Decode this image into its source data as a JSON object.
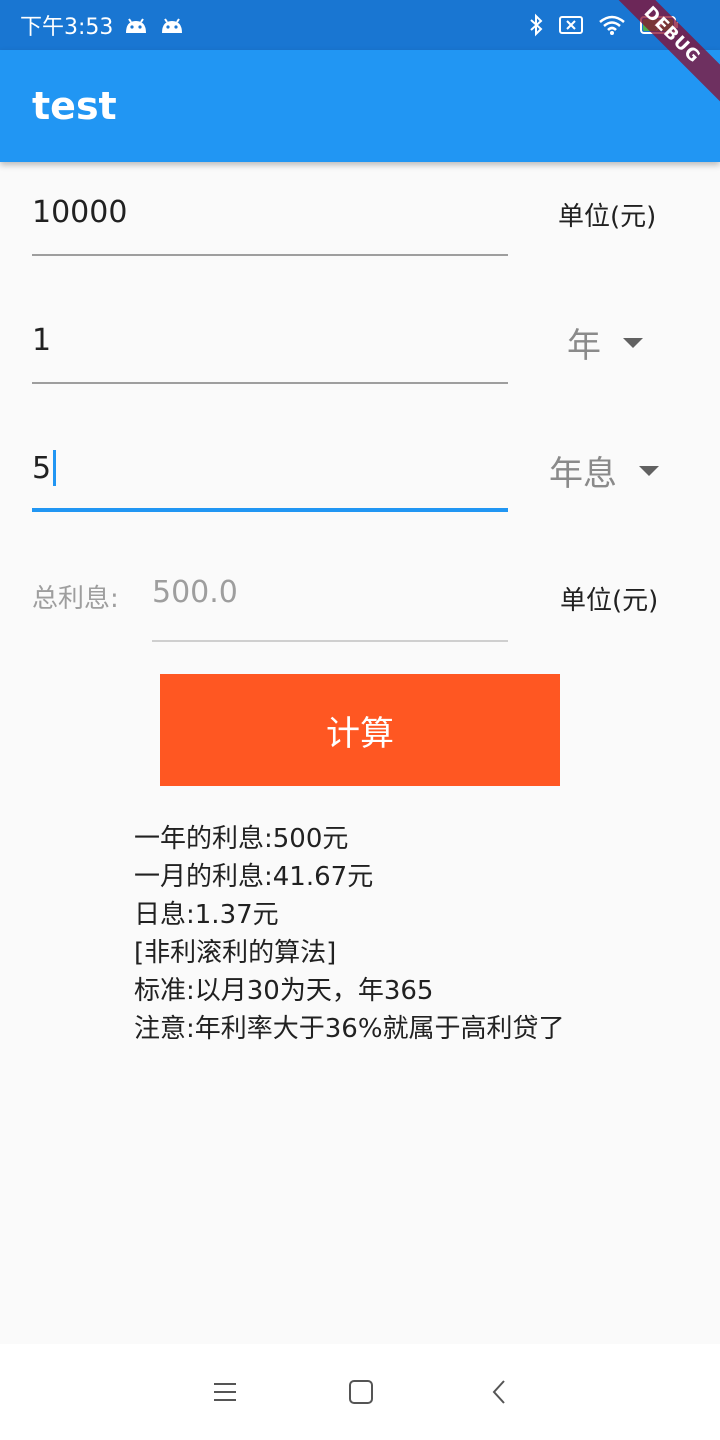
{
  "status_bar": {
    "time": "下午3:53",
    "icons": [
      "android-icon",
      "android-icon",
      "bluetooth-icon",
      "no-sim-icon",
      "wifi-icon",
      "battery-charging-icon"
    ]
  },
  "debug_banner": "DEBUG",
  "app_bar": {
    "title": "test"
  },
  "form": {
    "principal": {
      "value": "10000",
      "unit": "单位(元)"
    },
    "duration": {
      "value": "1",
      "unit_select": "年"
    },
    "rate": {
      "value": "5",
      "rate_type_select": "年息"
    },
    "total_interest": {
      "label": "总利息:",
      "value": "500.0",
      "unit": "单位(元)"
    }
  },
  "calculate_button": "计算",
  "results": [
    "一年的利息:500元",
    "一月的利息:41.67元",
    "日息:1.37元",
    "[非利滚利的算法]",
    "标准:以月30为天，年365",
    "注意:年利率大于36%就属于高利贷了"
  ],
  "nav_bar": {
    "buttons": [
      "menu-icon",
      "home-icon",
      "back-icon"
    ]
  },
  "colors": {
    "status_bar": "#1976d2",
    "app_bar": "#2196f3",
    "accent": "#2196f3",
    "button": "#ff5722"
  }
}
